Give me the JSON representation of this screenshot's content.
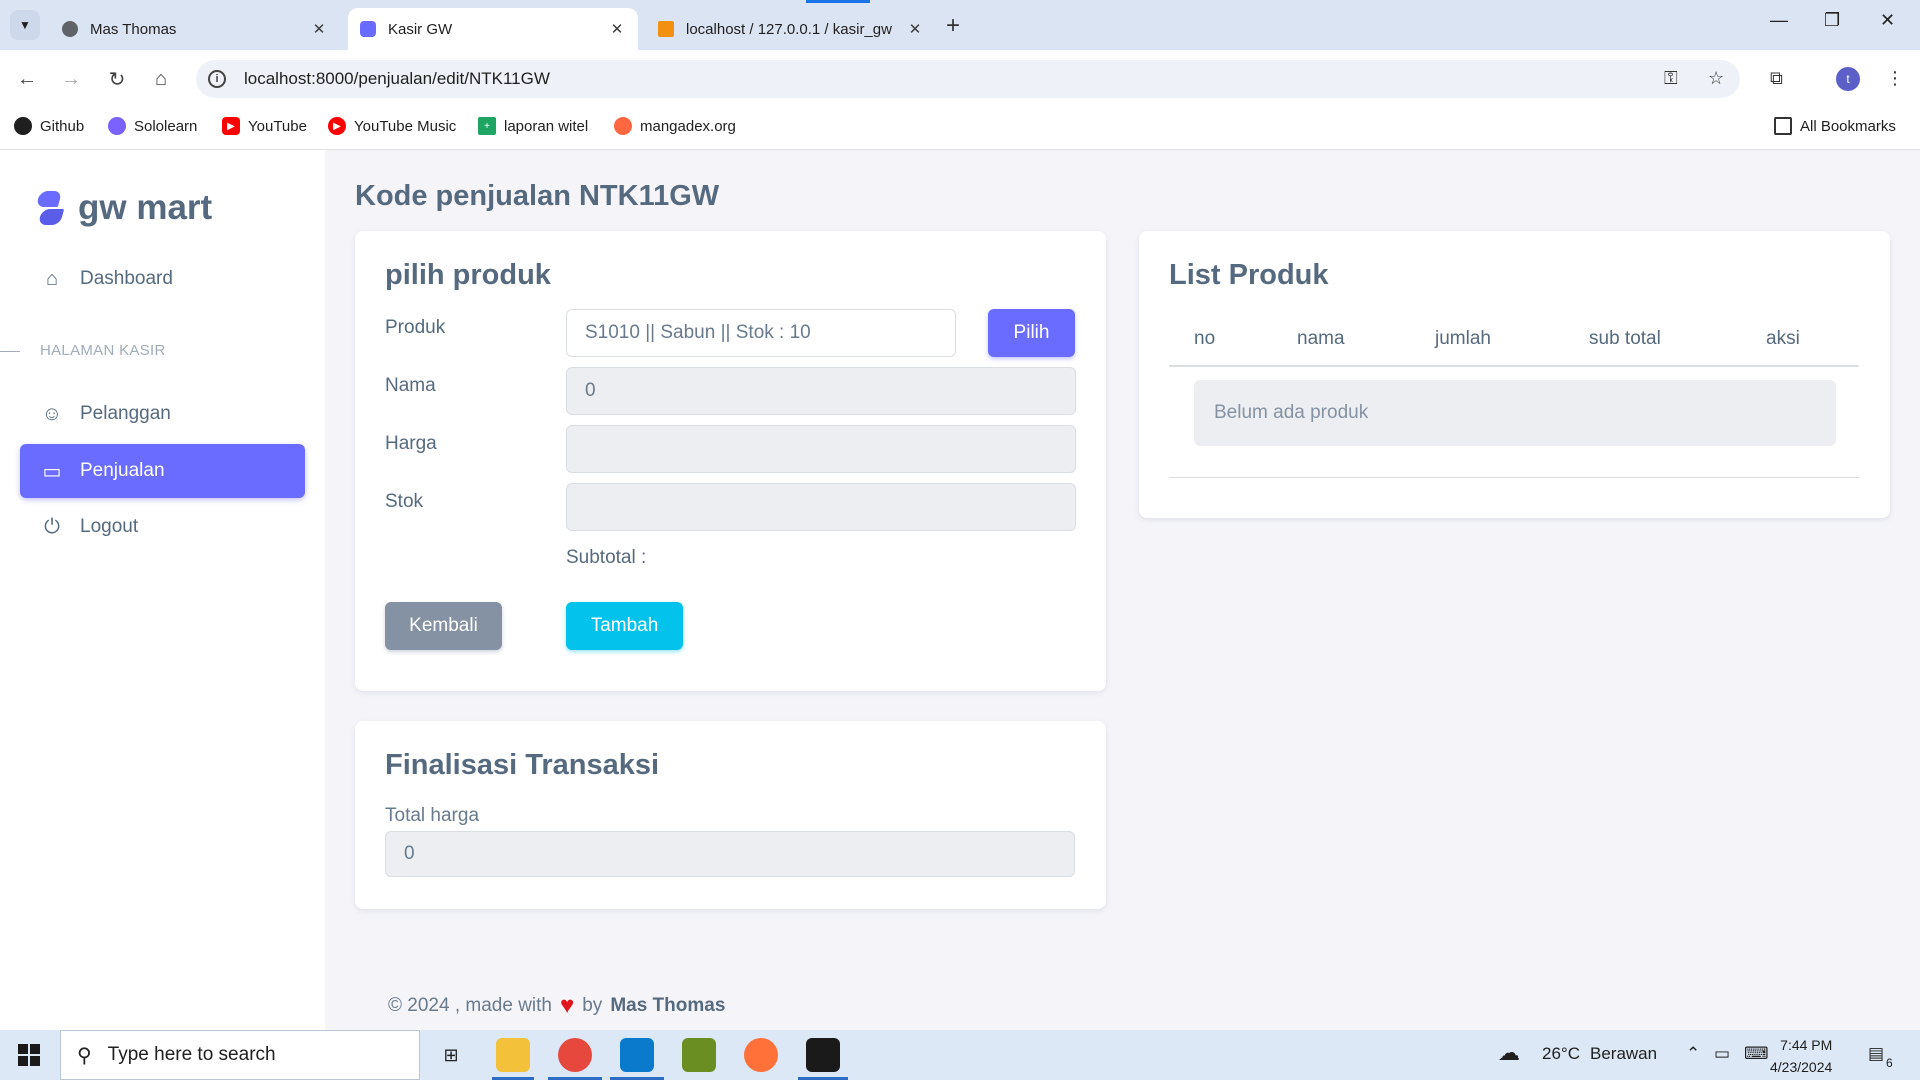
{
  "browser": {
    "tabs": [
      {
        "title": "Mas Thomas",
        "active": false
      },
      {
        "title": "Kasir GW",
        "active": true
      },
      {
        "title": "localhost / 127.0.0.1 / kasir_gw",
        "active": false
      }
    ],
    "url": "localhost:8000/penjualan/edit/NTK11GW",
    "profile_initial": "t",
    "bookmarks": [
      "Github",
      "Sololearn",
      "YouTube",
      "YouTube Music",
      "laporan witel",
      "mangadex.org"
    ],
    "all_bookmarks": "All Bookmarks"
  },
  "sidebar": {
    "brand": "gw mart",
    "items": [
      {
        "label": "Dashboard",
        "icon": "home-icon"
      },
      {
        "label": "Pelanggan",
        "icon": "user-icon"
      },
      {
        "label": "Penjualan",
        "icon": "credit-card-icon",
        "active": true
      },
      {
        "label": "Logout",
        "icon": "power-icon"
      }
    ],
    "section_header": "HALAMAN KASIR"
  },
  "page": {
    "title": "Kode penjualan NTK11GW"
  },
  "pilih_produk": {
    "title": "pilih produk",
    "produk_label": "Produk",
    "produk_value": "S1010 || Sabun || Stok : 10",
    "pilih_button": "Pilih",
    "nama_label": "Nama",
    "nama_value": "0",
    "harga_label": "Harga",
    "harga_value": "",
    "stok_label": "Stok",
    "stok_value": "",
    "subtotal_label": "Subtotal :",
    "kembali_button": "Kembali",
    "tambah_button": "Tambah"
  },
  "list_produk": {
    "title": "List Produk",
    "columns": [
      "no",
      "nama",
      "jumlah",
      "sub total",
      "aksi"
    ],
    "empty_message": "Belum ada produk"
  },
  "finalisasi": {
    "title": "Finalisasi Transaksi",
    "total_label": "Total harga",
    "total_value": "0"
  },
  "footer": {
    "prefix": "© 2024 , made with",
    "by": "by",
    "author": "Mas Thomas"
  },
  "taskbar": {
    "search_placeholder": "Type here to search",
    "weather_temp": "26°C",
    "weather_desc": "Berawan",
    "time": "7:44 PM",
    "date": "4/23/2024",
    "notification_count": "6"
  },
  "colors": {
    "primary": "#696cff",
    "secondary": "#8592a3",
    "info": "#03c3ec",
    "text": "#566a7f"
  }
}
